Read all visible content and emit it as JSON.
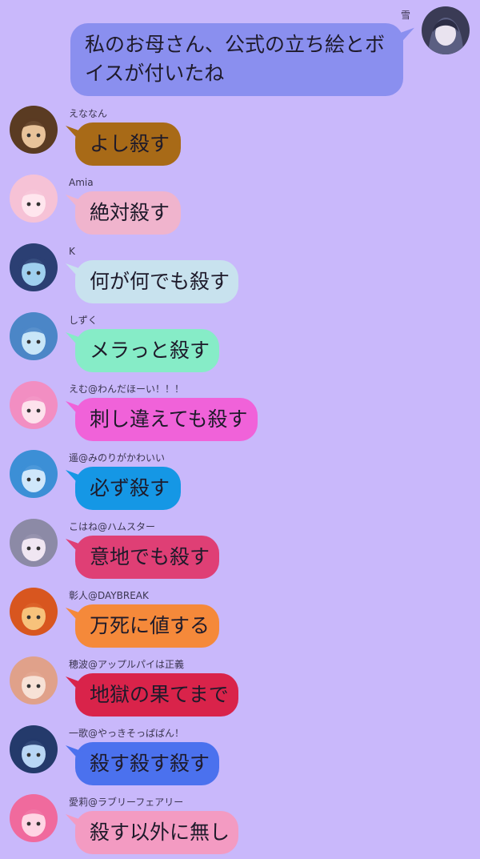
{
  "chat": {
    "self_message": {
      "sender": "雪",
      "text": "私のお母さん、公式の立ち絵とボイスが付いたね",
      "color": "#8a8fef"
    },
    "messages": [
      {
        "sender": "えななん",
        "text": "よし殺す",
        "color": "#a86a17",
        "avatar_color": "#5a3b22",
        "avatar_accent": "#e8c39a"
      },
      {
        "sender": "Amia",
        "text": "絶対殺す",
        "color": "#f0b4cd",
        "avatar_color": "#f6c2d6",
        "avatar_accent": "#ffe6ee"
      },
      {
        "sender": "K",
        "text": "何が何でも殺す",
        "color": "#c8e2ee",
        "avatar_color": "#2b3f73",
        "avatar_accent": "#9fd0ef"
      },
      {
        "sender": "しずく",
        "text": "メラっと殺す",
        "color": "#86ecc7",
        "avatar_color": "#4b86c7",
        "avatar_accent": "#c8e6f8"
      },
      {
        "sender": "えむ@わんだほーい！！！",
        "text": "刺し違えても殺す",
        "color": "#f062d9",
        "avatar_color": "#f28ec2",
        "avatar_accent": "#fde2ec"
      },
      {
        "sender": "遥@みのりがかわいい",
        "text": "必ず殺す",
        "color": "#1597e5",
        "avatar_color": "#3c8fd6",
        "avatar_accent": "#cfe7fb"
      },
      {
        "sender": "こはね@ハムスター",
        "text": "意地でも殺す",
        "color": "#df3f75",
        "avatar_color": "#8c8aa6",
        "avatar_accent": "#f0e6f2"
      },
      {
        "sender": "彰人@DAYBREAK",
        "text": "万死に値する",
        "color": "#f5893a",
        "avatar_color": "#d8561f",
        "avatar_accent": "#f7c27b"
      },
      {
        "sender": "穂波@アップルパイは正義",
        "text": "地獄の果てまで",
        "color": "#d9234a",
        "avatar_color": "#e0a18a",
        "avatar_accent": "#f7e1d6"
      },
      {
        "sender": "一歌@やっきそっぱぱん！",
        "text": "殺す殺す殺す",
        "color": "#4b71ee",
        "avatar_color": "#243a6b",
        "avatar_accent": "#b8d6f5"
      },
      {
        "sender": "愛莉@ラブリーフェアリー",
        "text": "殺す以外に無し",
        "color": "#f39bc2",
        "avatar_color": "#f06a9d",
        "avatar_accent": "#ffd5e4"
      }
    ]
  },
  "background_color": "#c9b8fb"
}
